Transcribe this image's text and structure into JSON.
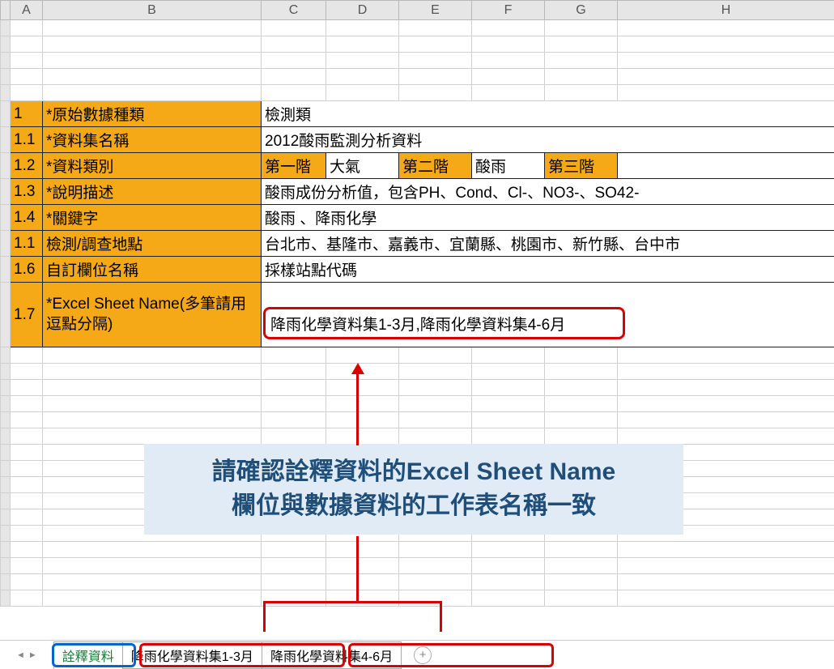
{
  "columns": [
    "A",
    "B",
    "C",
    "D",
    "E",
    "F",
    "G",
    "H"
  ],
  "rows": {
    "r1": {
      "a": "1",
      "b": "*原始數據種類",
      "c": "檢測類"
    },
    "r2": {
      "a": "1.1",
      "b": "*資料集名稱",
      "c": "2012酸雨監測分析資料"
    },
    "r3": {
      "a": "1.2",
      "b": "*資料類別",
      "c": "第一階",
      "d": "大氣",
      "e": "第二階",
      "f": "酸雨",
      "g": "第三階",
      "h": ""
    },
    "r4": {
      "a": "1.3",
      "b": "*說明描述",
      "c": "酸雨成份分析值，包含PH、Cond、Cl-、NO3-、SO42-"
    },
    "r5": {
      "a": "1.4",
      "b": "*關鍵字",
      "c": "酸雨 、降雨化學"
    },
    "r6": {
      "a": "1.1",
      "b": "檢測/調查地點",
      "c": "台北市、基隆市、嘉義市、宜蘭縣、桃園市、新竹縣、台中市"
    },
    "r7": {
      "a": "1.6",
      "b": "自訂欄位名稱",
      "c": "採樣站點代碼"
    },
    "r8": {
      "a": "1.7",
      "b": "*Excel Sheet Name(多筆請用逗點分隔)",
      "c": "降雨化學資料集1-3月,降雨化學資料集4-6月"
    }
  },
  "callout": {
    "line1": "請確認詮釋資料的Excel Sheet Name",
    "line2": "欄位與數據資料的工作表名稱一致"
  },
  "tabs": {
    "t1": "詮釋資料",
    "t2": "降雨化學資料集1-3月",
    "t3": "降雨化學資料集4-6月"
  }
}
